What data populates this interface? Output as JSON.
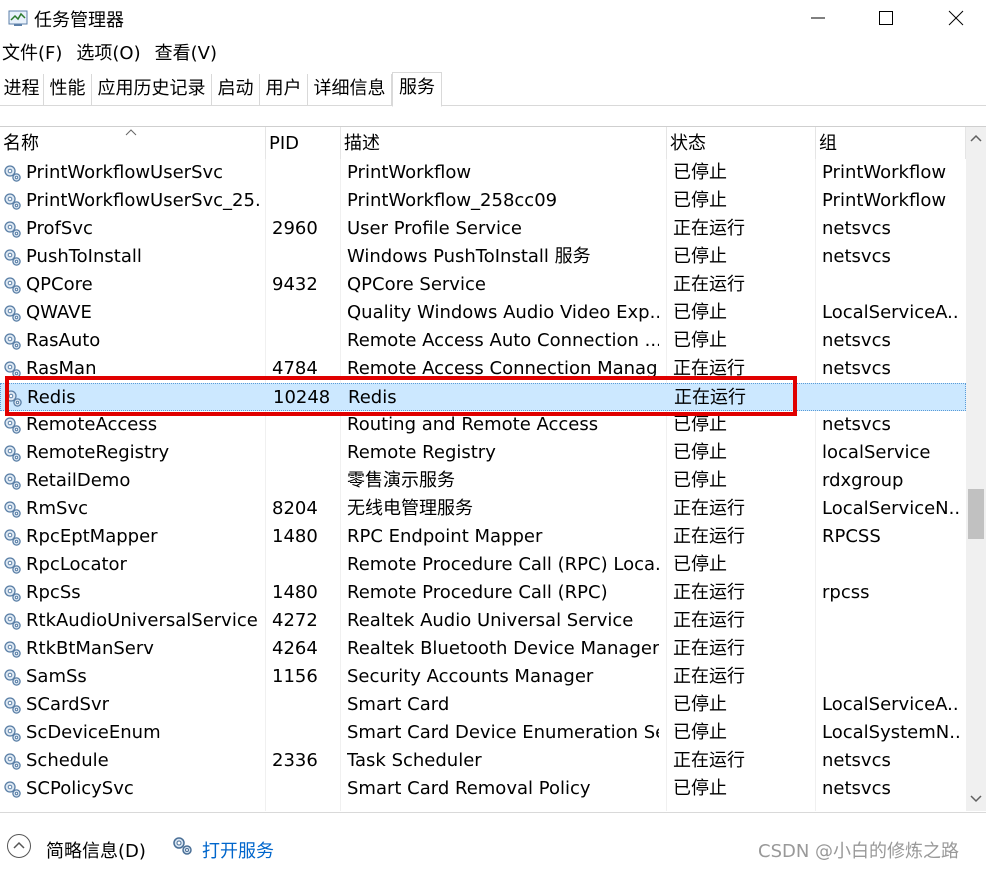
{
  "window": {
    "title": "任务管理器"
  },
  "menu": [
    "文件(F)",
    "选项(O)",
    "查看(V)"
  ],
  "tabs": [
    "进程",
    "性能",
    "应用历史记录",
    "启动",
    "用户",
    "详细信息",
    "服务"
  ],
  "active_tab": "服务",
  "columns": {
    "name": "名称",
    "pid": "PID",
    "desc": "描述",
    "status": "状态",
    "group": "组"
  },
  "rows": [
    {
      "name": "PrintWorkflowUserSvc",
      "pid": "",
      "desc": "PrintWorkflow",
      "status": "已停止",
      "group": "PrintWorkflow"
    },
    {
      "name": "PrintWorkflowUserSvc_25...",
      "pid": "",
      "desc": "PrintWorkflow_258cc09",
      "status": "已停止",
      "group": "PrintWorkflow"
    },
    {
      "name": "ProfSvc",
      "pid": "2960",
      "desc": "User Profile Service",
      "status": "正在运行",
      "group": "netsvcs"
    },
    {
      "name": "PushToInstall",
      "pid": "",
      "desc": "Windows PushToInstall 服务",
      "status": "已停止",
      "group": "netsvcs"
    },
    {
      "name": "QPCore",
      "pid": "9432",
      "desc": "QPCore Service",
      "status": "正在运行",
      "group": ""
    },
    {
      "name": "QWAVE",
      "pid": "",
      "desc": "Quality Windows Audio Video Exp...",
      "status": "已停止",
      "group": "LocalServiceA..."
    },
    {
      "name": "RasAuto",
      "pid": "",
      "desc": "Remote Access Auto Connection ...",
      "status": "已停止",
      "group": "netsvcs"
    },
    {
      "name": "RasMan",
      "pid": "4784",
      "desc": "Remote Access Connection Manag...",
      "status": "正在运行",
      "group": "netsvcs"
    },
    {
      "name": "Redis",
      "pid": "10248",
      "desc": "Redis",
      "status": "正在运行",
      "group": ""
    },
    {
      "name": "RemoteAccess",
      "pid": "",
      "desc": "Routing and Remote Access",
      "status": "已停止",
      "group": "netsvcs"
    },
    {
      "name": "RemoteRegistry",
      "pid": "",
      "desc": "Remote Registry",
      "status": "已停止",
      "group": "localService"
    },
    {
      "name": "RetailDemo",
      "pid": "",
      "desc": "零售演示服务",
      "status": "已停止",
      "group": "rdxgroup"
    },
    {
      "name": "RmSvc",
      "pid": "8204",
      "desc": "无线电管理服务",
      "status": "正在运行",
      "group": "LocalServiceN..."
    },
    {
      "name": "RpcEptMapper",
      "pid": "1480",
      "desc": "RPC Endpoint Mapper",
      "status": "正在运行",
      "group": "RPCSS"
    },
    {
      "name": "RpcLocator",
      "pid": "",
      "desc": "Remote Procedure Call (RPC) Loca...",
      "status": "已停止",
      "group": ""
    },
    {
      "name": "RpcSs",
      "pid": "1480",
      "desc": "Remote Procedure Call (RPC)",
      "status": "正在运行",
      "group": "rpcss"
    },
    {
      "name": "RtkAudioUniversalService",
      "pid": "4272",
      "desc": "Realtek Audio Universal Service",
      "status": "正在运行",
      "group": ""
    },
    {
      "name": "RtkBtManServ",
      "pid": "4264",
      "desc": "Realtek Bluetooth Device Manager...",
      "status": "正在运行",
      "group": ""
    },
    {
      "name": "SamSs",
      "pid": "1156",
      "desc": "Security Accounts Manager",
      "status": "正在运行",
      "group": ""
    },
    {
      "name": "SCardSvr",
      "pid": "",
      "desc": "Smart Card",
      "status": "已停止",
      "group": "LocalServiceA..."
    },
    {
      "name": "ScDeviceEnum",
      "pid": "",
      "desc": "Smart Card Device Enumeration Se...",
      "status": "已停止",
      "group": "LocalSystemN..."
    },
    {
      "name": "Schedule",
      "pid": "2336",
      "desc": "Task Scheduler",
      "status": "正在运行",
      "group": "netsvcs"
    },
    {
      "name": "SCPolicySvc",
      "pid": "",
      "desc": "Smart Card Removal Policy",
      "status": "已停止",
      "group": "netsvcs"
    }
  ],
  "selected_row": "Redis",
  "footer": {
    "brief": "简略信息(D)",
    "open_services": "打开服务",
    "watermark": "CSDN @小白的修炼之路"
  },
  "colors": {
    "selection": "#cce8ff",
    "highlight_border": "#e00000",
    "link": "#0066cc"
  }
}
